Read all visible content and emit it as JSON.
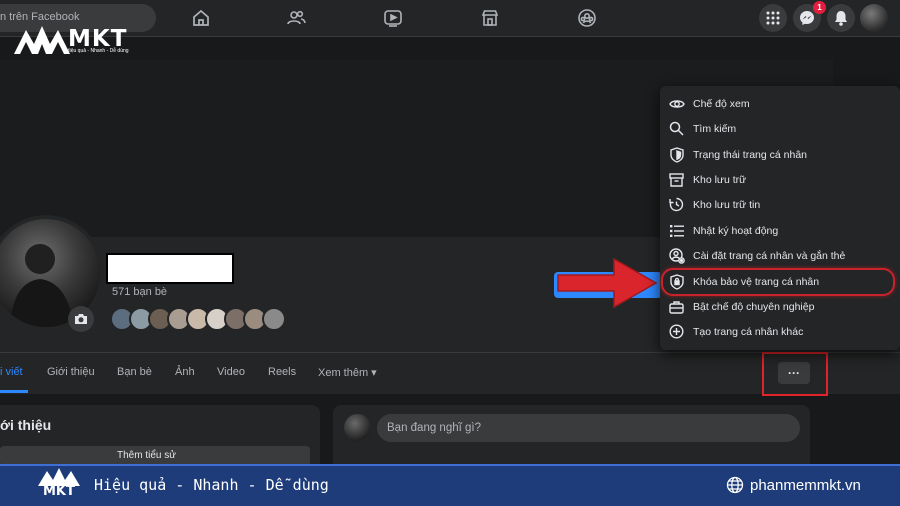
{
  "topnav": {
    "search_placeholder": "Tìm trên Facebook",
    "search_visible": "n trên Facebook",
    "nav_icons": [
      "home-icon",
      "friends-icon",
      "video-icon",
      "marketplace-icon",
      "groups-icon"
    ],
    "messenger_badge": "1"
  },
  "logo": {
    "brand": "MKT",
    "tagline": "Hiệu quả - Nhanh - Dễ dùng"
  },
  "profile": {
    "friends_count": "571 bạn bè"
  },
  "tabs": [
    {
      "label": "i viết",
      "active": true
    },
    {
      "label": "Giới thiệu"
    },
    {
      "label": "Bạn bè"
    },
    {
      "label": "Ảnh"
    },
    {
      "label": "Video"
    },
    {
      "label": "Reels"
    },
    {
      "label": "Xem thêm ▾"
    }
  ],
  "more_button": "···",
  "intro": {
    "title": "ới thiệu",
    "bio_button": "Thêm tiểu sử"
  },
  "composer": {
    "placeholder": "Bạn đang nghĩ gì?"
  },
  "menu": {
    "items": [
      {
        "icon": "eye-icon",
        "label": "Chế độ xem"
      },
      {
        "icon": "search-icon",
        "label": "Tìm kiếm"
      },
      {
        "icon": "shield-icon",
        "label": "Trạng thái trang cá nhân"
      },
      {
        "icon": "archive-icon",
        "label": "Kho lưu trữ"
      },
      {
        "icon": "story-archive-icon",
        "label": "Kho lưu trữ tin"
      },
      {
        "icon": "list-icon",
        "label": "Nhật ký hoạt động"
      },
      {
        "icon": "profile-settings-icon",
        "label": "Cài đặt trang cá nhân và gắn thẻ"
      },
      {
        "icon": "lock-shield-icon",
        "label": "Khóa bảo vệ trang cá nhân"
      },
      {
        "icon": "briefcase-icon",
        "label": "Bật chế độ chuyên nghiệp"
      },
      {
        "icon": "plus-circle-icon",
        "label": "Tạo trang cá nhân khác"
      }
    ]
  },
  "banner": {
    "brand": "MKT",
    "slogan": "Hiệu quả - Nhanh - Dễ dùng",
    "website": "phanmemmkt.vn"
  },
  "colors": {
    "background": "#18191a",
    "surface": "#242526",
    "accent": "#2d88ff",
    "highlight_red": "#e0242a",
    "banner": "#1e3c79"
  }
}
